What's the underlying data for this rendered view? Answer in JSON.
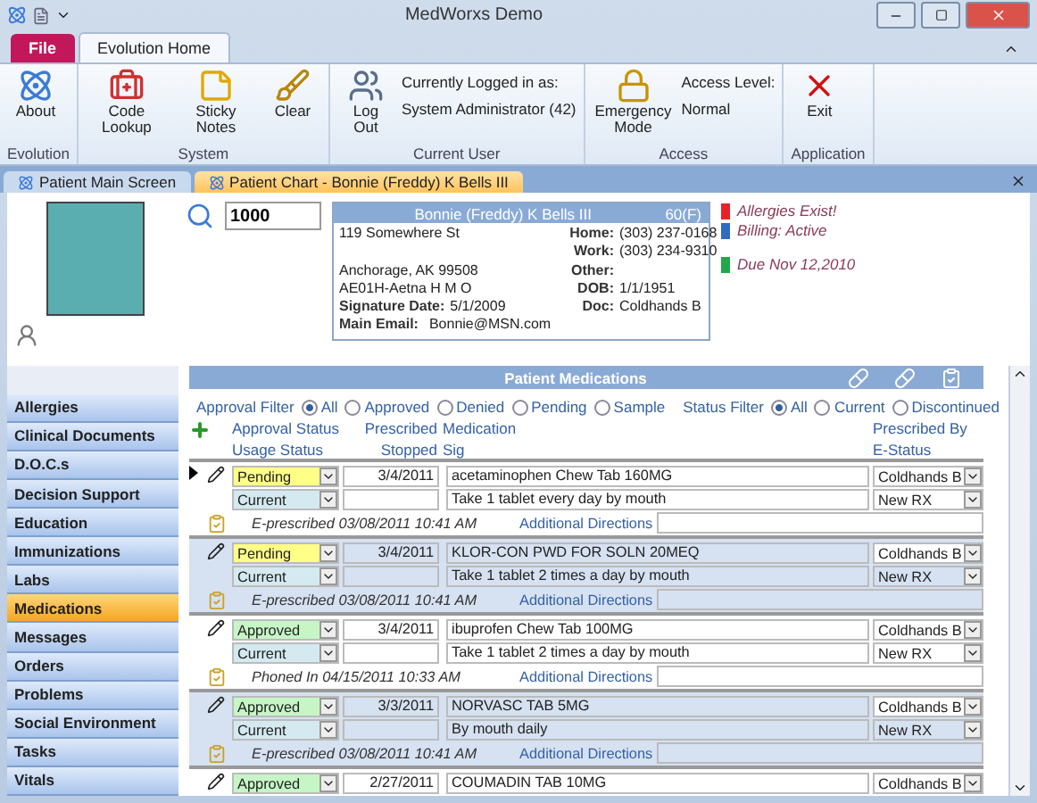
{
  "window": {
    "title": "MedWorxs Demo"
  },
  "ribbon_tabs": [
    {
      "label": "File",
      "kind": "file",
      "selected": false
    },
    {
      "label": "Evolution Home",
      "kind": "tab",
      "selected": true
    }
  ],
  "ribbon_groups": [
    {
      "label": "Evolution",
      "buttons": [
        "About"
      ]
    },
    {
      "label": "System",
      "buttons": [
        "Code Lookup",
        "Sticky Notes",
        "Clear"
      ]
    },
    {
      "label": "Current User",
      "buttons": [
        "Log Out"
      ],
      "info": [
        "Currently Logged in as:",
        "System Administrator (42)"
      ]
    },
    {
      "label": "Access",
      "buttons": [
        "Emergency Mode"
      ],
      "info": [
        "Access Level:",
        "Normal"
      ]
    },
    {
      "label": "Application",
      "buttons": [
        "Exit"
      ]
    }
  ],
  "doc_tabs": [
    {
      "label": "Patient Main Screen",
      "selected": false
    },
    {
      "label": "Patient Chart - Bonnie (Freddy) K Bells III",
      "selected": true
    }
  ],
  "patient": {
    "id": "1000",
    "name": "Bonnie (Freddy) K Bells III",
    "age_sex": "60(F)",
    "address": [
      "119 Somewhere St",
      "Anchorage, AK  99508",
      "AE01H-Aetna H M O"
    ],
    "signature_label": "Signature Date:",
    "signature_date": "5/1/2009",
    "email_label": "Main Email:",
    "email": "Bonnie@MSN.com",
    "contacts": [
      {
        "label": "Home:",
        "value": "(303) 237-0168"
      },
      {
        "label": "Work:",
        "value": "(303) 234-9310"
      },
      {
        "label": "Other:"
      },
      {
        "label": "DOB:",
        "value": "1/1/1951"
      },
      {
        "label": "Doc:",
        "value": "Coldhands B"
      }
    ],
    "alerts": [
      {
        "text": "Allergies Exist!",
        "color": "#e8202a"
      },
      {
        "text": "Billing: Active",
        "color": "#2f6cc0"
      },
      {
        "text": "Due Nov 12,2010",
        "color": "#22a84a"
      }
    ]
  },
  "sidebar": {
    "items": [
      {
        "label": "Allergies",
        "selected": false
      },
      {
        "label": "Clinical Documents",
        "selected": false
      },
      {
        "label": "D.O.C.s",
        "selected": false
      },
      {
        "label": "Decision Support",
        "selected": false
      },
      {
        "label": "Education",
        "selected": false
      },
      {
        "label": "Immunizations",
        "selected": false
      },
      {
        "label": "Labs",
        "selected": false
      },
      {
        "label": "Medications",
        "selected": true
      },
      {
        "label": "Messages",
        "selected": false
      },
      {
        "label": "Orders",
        "selected": false
      },
      {
        "label": "Problems",
        "selected": false
      },
      {
        "label": "Social Environment",
        "selected": false
      },
      {
        "label": "Tasks",
        "selected": false
      },
      {
        "label": "Vitals",
        "selected": false
      }
    ]
  },
  "medications": {
    "title": "Patient Medications",
    "approval_filter": {
      "label": "Approval Filter",
      "options": [
        {
          "label": "All",
          "selected": true
        },
        {
          "label": "Approved",
          "selected": false
        },
        {
          "label": "Denied",
          "selected": false
        },
        {
          "label": "Pending",
          "selected": false
        },
        {
          "label": "Sample",
          "selected": false
        }
      ]
    },
    "status_filter": {
      "label": "Status Filter",
      "options": [
        {
          "label": "All",
          "selected": true
        },
        {
          "label": "Current",
          "selected": false
        },
        {
          "label": "Discontinued",
          "selected": false
        }
      ]
    },
    "columns": {
      "approval": "Approval Status",
      "usage": "Usage Status",
      "prescribed": "Prescribed",
      "stopped": "Stopped",
      "medication": "Medication",
      "sig": "Sig",
      "prescribed_by": "Prescribed By",
      "e_status": "E-Status"
    },
    "rows": [
      {
        "current": true,
        "approval": {
          "value": "Pending",
          "color": "#ffff88"
        },
        "usage": "Current",
        "prescribed": "3/4/2011",
        "medication": "acetaminophen Chew Tab 160MG",
        "sig": "Take 1 tablet every day by mouth",
        "note": "E-prescribed 03/08/2011 10:41 AM",
        "directions_label": "Additional Directions",
        "prescribed_by": "Coldhands B",
        "e_status": "New RX"
      },
      {
        "current": false,
        "approval": {
          "value": "Pending",
          "color": "#ffff88"
        },
        "usage": "Current",
        "prescribed": "3/4/2011",
        "medication": "KLOR-CON PWD FOR SOLN 20MEQ",
        "sig": "Take 1 tablet 2 times a day by mouth",
        "note": "E-prescribed 03/08/2011 10:41 AM",
        "directions_label": "Additional Directions",
        "prescribed_by": "Coldhands B",
        "e_status": "New RX"
      },
      {
        "current": false,
        "approval": {
          "value": "Approved",
          "color": "#c6f5c6"
        },
        "usage": "Current",
        "prescribed": "3/4/2011",
        "medication": "ibuprofen Chew Tab 100MG",
        "sig": "Take 1 tablet 2 times a day by mouth",
        "note": "Phoned In 04/15/2011 10:33 AM",
        "directions_label": "Additional Directions",
        "prescribed_by": "Coldhands B",
        "e_status": "New RX"
      },
      {
        "current": false,
        "approval": {
          "value": "Approved",
          "color": "#c6f5c6"
        },
        "usage": "Current",
        "prescribed": "3/3/2011",
        "medication": "NORVASC TAB 5MG",
        "sig": "By mouth daily",
        "note": "E-prescribed 03/08/2011 10:41 AM",
        "directions_label": "Additional Directions",
        "prescribed_by": "Coldhands B",
        "e_status": "New RX"
      },
      {
        "current": false,
        "approval": {
          "value": "Approved",
          "color": "#c6f5c6"
        },
        "prescribed": "2/27/2011",
        "medication": "COUMADIN TAB 10MG",
        "prescribed_by": "Coldhands B"
      }
    ]
  }
}
